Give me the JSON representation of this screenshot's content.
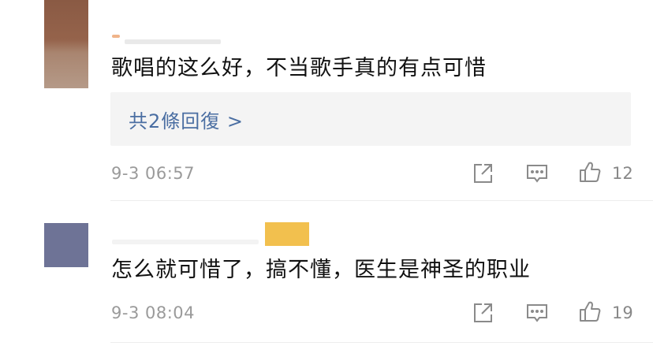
{
  "comments": [
    {
      "text": "歌唱的这么好，不当歌手真的有点可惜",
      "reply_label": "共2條回復 >",
      "time": "9-3 06:57",
      "likes": "12",
      "icons": [
        "share-icon",
        "comment-icon",
        "like-icon"
      ]
    },
    {
      "text": "怎么就可惜了，搞不懂，医生是神圣的职业",
      "time": "9-3 08:04",
      "likes": "19",
      "icons": [
        "share-icon",
        "comment-icon",
        "like-icon"
      ]
    }
  ],
  "colors": {
    "link": "#4a6ea2",
    "meta": "#9a9a9a",
    "reply_bg": "#f4f4f4",
    "sticker": "#f2c04e"
  }
}
